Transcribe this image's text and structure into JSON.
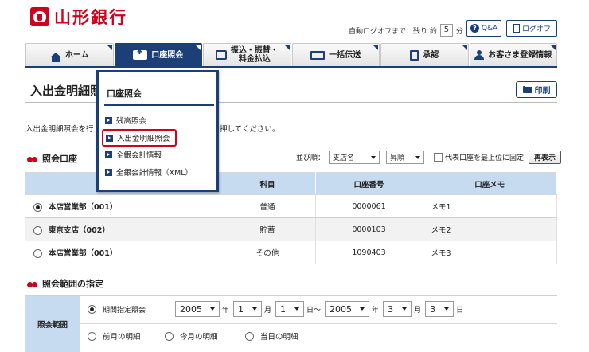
{
  "header": {
    "logo_text": "山形銀行",
    "autologoff_prefix": "自動ログオフまで：残り 約",
    "autologoff_minutes": "5",
    "autologoff_unit": "分",
    "qa_label": "Q&A",
    "logoff_label": "ログオフ"
  },
  "nav": {
    "tabs": [
      {
        "label": "ホーム",
        "icon": "home-icon"
      },
      {
        "label": "口座照会",
        "icon": "yen-icon"
      },
      {
        "label": "振込・振替・\n料金払込",
        "icon": "transfer-icon"
      },
      {
        "label": "一括伝送",
        "icon": "batch-icon"
      },
      {
        "label": "承認",
        "icon": "approve-icon"
      },
      {
        "label": "お客さま登録情報",
        "icon": "user-icon"
      }
    ]
  },
  "page": {
    "title": "入出金明細照",
    "print_label": "印刷",
    "description_head": "入出金明細照会を行",
    "description_tail": "押してください。"
  },
  "dropdown": {
    "title": "口座照会",
    "items": [
      "残高照会",
      "入出金明細照会",
      "全銀会計情報",
      "全銀会計情報（XML）"
    ],
    "selected_index": 1
  },
  "accounts": {
    "heading": "照会口座",
    "sort_label": "並び順：",
    "sort_key": "支店名",
    "sort_order": "昇順",
    "fix_label": "代表口座を最上位に固定",
    "redisplay_label": "再表示",
    "columns": [
      "支店",
      "科目",
      "口座番号",
      "口座メモ"
    ],
    "rows": [
      {
        "branch": "本店営業部（001）",
        "type": "普通",
        "number": "0000061",
        "memo": "メモ1",
        "selected": true
      },
      {
        "branch": "東京支店（002）",
        "type": "貯蓄",
        "number": "0000103",
        "memo": "メモ2",
        "selected": false
      },
      {
        "branch": "本店営業部（001）",
        "type": "その他",
        "number": "1090403",
        "memo": "メモ3",
        "selected": false
      }
    ]
  },
  "range": {
    "heading": "照会範囲の指定",
    "label": "照会範囲",
    "period_label": "期間指定照会",
    "from": {
      "year": "2005",
      "month": "1",
      "day": "1"
    },
    "to": {
      "year": "2005",
      "month": "3",
      "day": "3"
    },
    "year_unit": "年",
    "month_unit": "月",
    "day_unit": "日",
    "tilde": "日〜",
    "options": [
      "前月の明細",
      "今月の明細",
      "当日の明細"
    ]
  },
  "colors": {
    "brand_red": "#d0021b",
    "navy": "#1c3f78",
    "header_blue": "#c6daf0"
  }
}
